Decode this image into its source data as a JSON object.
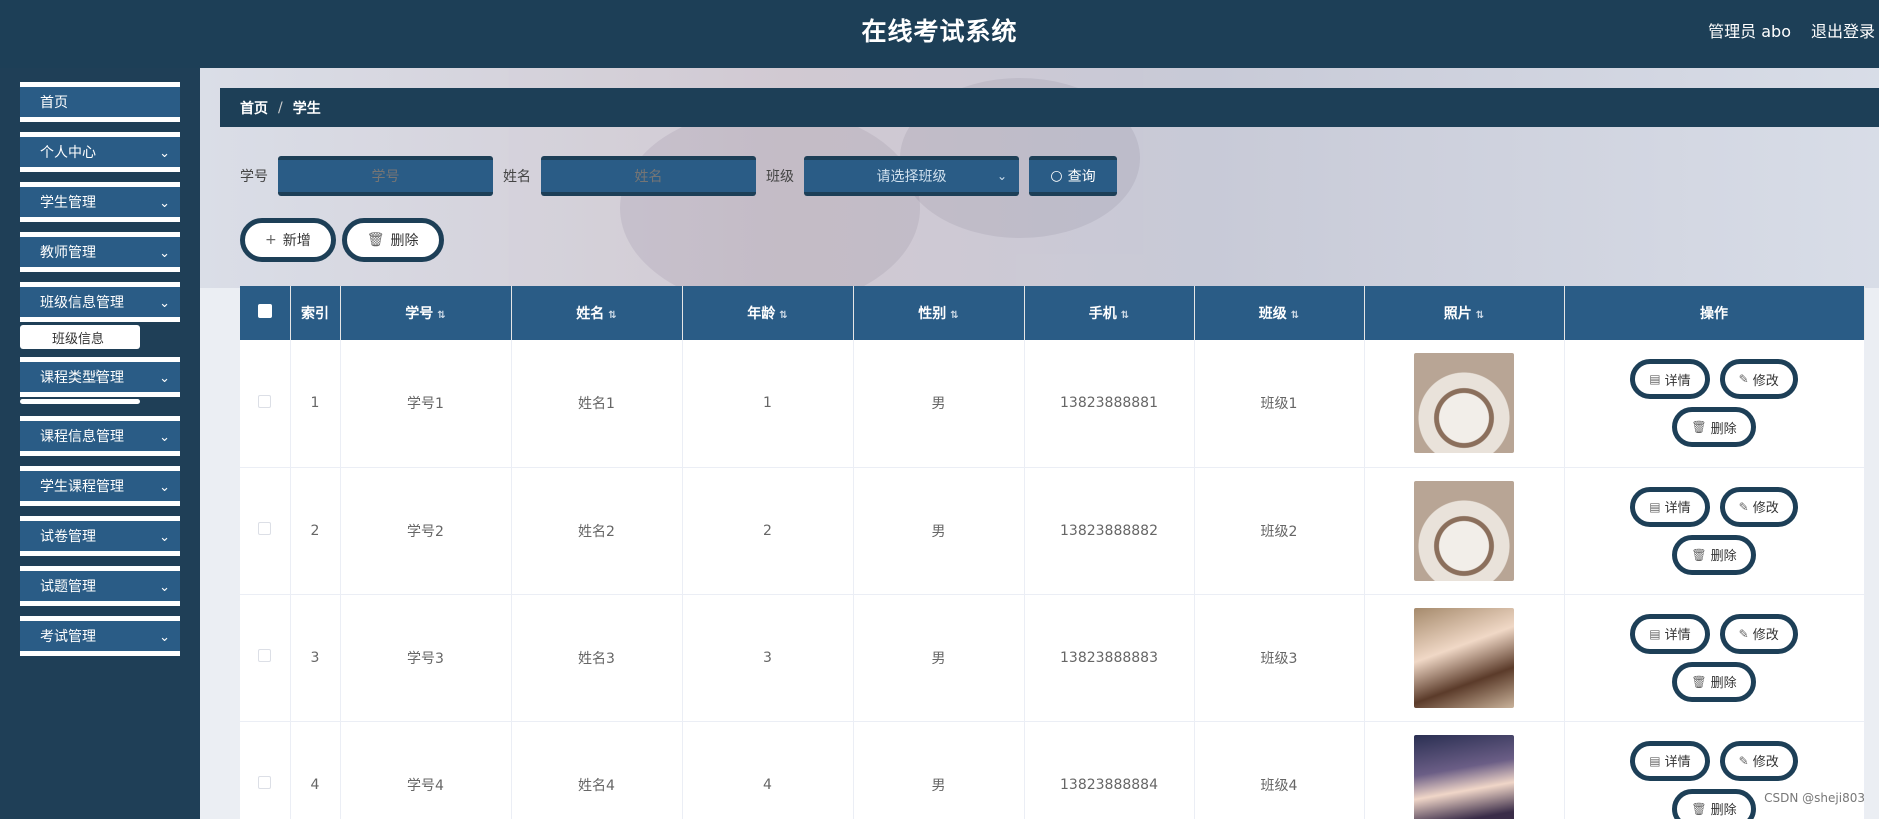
{
  "header": {
    "title": "在线考试系统",
    "user": "管理员 abo",
    "logout": "退出登录"
  },
  "sidebar": {
    "items": [
      {
        "label": "首页",
        "expandable": false
      },
      {
        "label": "个人中心",
        "expandable": true
      },
      {
        "label": "学生管理",
        "expandable": true
      },
      {
        "label": "教师管理",
        "expandable": true
      },
      {
        "label": "班级信息管理",
        "expandable": true
      },
      {
        "label": "课程类型管理",
        "expandable": true
      },
      {
        "label": "课程信息管理",
        "expandable": true
      },
      {
        "label": "学生课程管理",
        "expandable": true
      },
      {
        "label": "试卷管理",
        "expandable": true
      },
      {
        "label": "试题管理",
        "expandable": true
      },
      {
        "label": "考试管理",
        "expandable": true
      }
    ],
    "sub_item": "班级信息"
  },
  "breadcrumb": {
    "home": "首页",
    "sep": "/",
    "current": "学生"
  },
  "search": {
    "student_no_label": "学号",
    "student_no_placeholder": "学号",
    "name_label": "姓名",
    "name_placeholder": "姓名",
    "class_label": "班级",
    "class_placeholder": "请选择班级",
    "query_button": "查询"
  },
  "actions": {
    "add": "新增",
    "delete": "删除"
  },
  "table": {
    "columns": [
      "",
      "索引",
      "学号",
      "姓名",
      "年龄",
      "性别",
      "手机",
      "班级",
      "照片",
      "操作"
    ],
    "rows": [
      {
        "index": "1",
        "student_no": "学号1",
        "name": "姓名1",
        "age": "1",
        "gender": "男",
        "phone": "13823888881",
        "class": "班级1"
      },
      {
        "index": "2",
        "student_no": "学号2",
        "name": "姓名2",
        "age": "2",
        "gender": "男",
        "phone": "13823888882",
        "class": "班级2"
      },
      {
        "index": "3",
        "student_no": "学号3",
        "name": "姓名3",
        "age": "3",
        "gender": "男",
        "phone": "13823888883",
        "class": "班级3"
      },
      {
        "index": "4",
        "student_no": "学号4",
        "name": "姓名4",
        "age": "4",
        "gender": "男",
        "phone": "13823888884",
        "class": "班级4"
      }
    ],
    "row_actions": {
      "detail": "详情",
      "edit": "修改",
      "delete": "删除"
    }
  },
  "watermark": "CSDN @sheji803",
  "colors": {
    "header_bg": "#1d3f57",
    "accent": "#2a5c86"
  },
  "icons": {
    "sort": "sort-icon",
    "chevron": "chevron-down-icon",
    "search": "search-icon"
  }
}
